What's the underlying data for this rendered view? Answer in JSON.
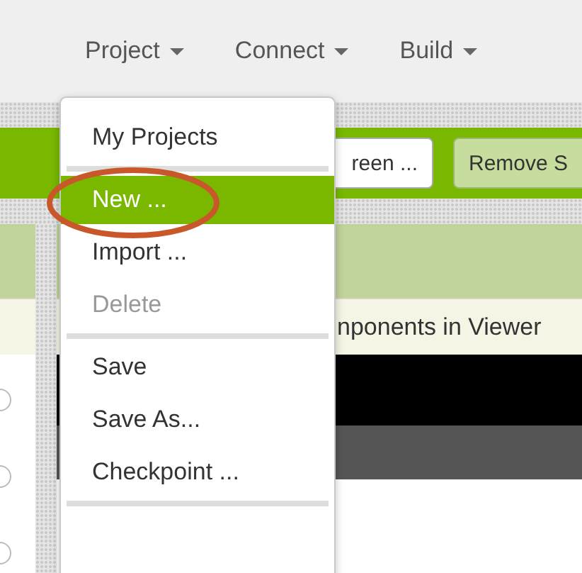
{
  "menubar": [
    {
      "label": "Project"
    },
    {
      "label": "Connect"
    },
    {
      "label": "Build"
    }
  ],
  "toolbar": {
    "buttons": [
      {
        "label": "reen ...",
        "kind": "plain"
      },
      {
        "label": "Remove S",
        "kind": "green"
      }
    ]
  },
  "viewer": {
    "option_text": "nponents in Viewer"
  },
  "project_menu": {
    "items": [
      {
        "kind": "item",
        "label": "My Projects",
        "selected": false,
        "disabled": false
      },
      {
        "kind": "divider"
      },
      {
        "kind": "item",
        "label": "New ...",
        "selected": true,
        "disabled": false
      },
      {
        "kind": "item",
        "label": "Import ...",
        "selected": false,
        "disabled": false
      },
      {
        "kind": "item",
        "label": "Delete",
        "selected": false,
        "disabled": true
      },
      {
        "kind": "divider"
      },
      {
        "kind": "item",
        "label": "Save",
        "selected": false,
        "disabled": false
      },
      {
        "kind": "item",
        "label": "Save As...",
        "selected": false,
        "disabled": false
      },
      {
        "kind": "item",
        "label": "Checkpoint ...",
        "selected": false,
        "disabled": false
      },
      {
        "kind": "divider"
      }
    ]
  }
}
